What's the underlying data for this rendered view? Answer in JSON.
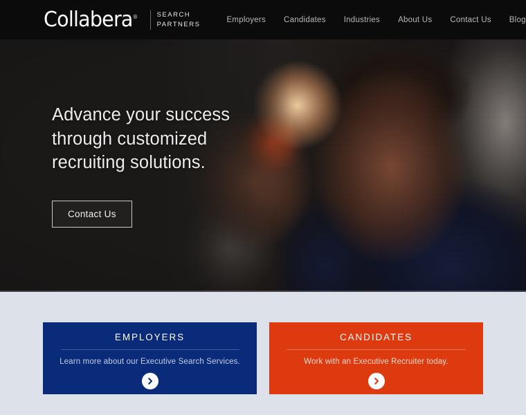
{
  "header": {
    "logo": {
      "name": "Collabera",
      "registered_mark": "®",
      "subtitle_line1": "SEARCH",
      "subtitle_line2": "PARTNERS"
    },
    "nav_items": [
      {
        "label": "Employers"
      },
      {
        "label": "Candidates"
      },
      {
        "label": "Industries"
      },
      {
        "label": "About Us"
      },
      {
        "label": "Contact Us"
      },
      {
        "label": "Blog"
      }
    ],
    "search_icon": "search-icon",
    "background_color": "#0b0b0c"
  },
  "hero": {
    "headline": "Advance your success through customized recruiting solutions.",
    "cta_label": "Contact Us",
    "image_description": "Two businessmen in suits smiling in a backlit meeting"
  },
  "cards": [
    {
      "title": "EMPLOYERS",
      "description": "Learn more about our Executive Search Services.",
      "arrow_icon": "chevron-right-icon",
      "background_color": "#0a2a7a",
      "arrow_color": "#0a2a7a"
    },
    {
      "title": "CANDIDATES",
      "description": "Work with an Executive Recruiter today.",
      "arrow_icon": "chevron-right-icon",
      "background_color": "#dd3a0f",
      "arrow_color": "#dd3a0f"
    }
  ],
  "colors": {
    "page_background": "#dde2ea",
    "header_background": "#0b0b0c",
    "employers_blue": "#0a2a7a",
    "candidates_orange": "#dd3a0f"
  }
}
